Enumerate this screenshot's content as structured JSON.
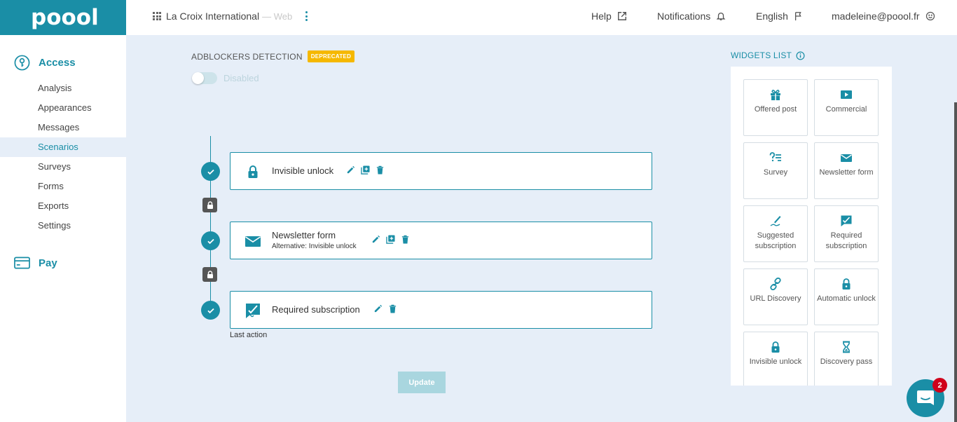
{
  "brand": {
    "logo": "poool",
    "accent": "#1a8ea6"
  },
  "header": {
    "site_name": "La Croix International",
    "site_type": "— Web",
    "help": "Help",
    "notifications": "Notifications",
    "language": "English",
    "user": "madeleine@poool.fr"
  },
  "sidebar": {
    "access_title": "Access",
    "pay_title": "Pay",
    "items": [
      {
        "label": "Analysis"
      },
      {
        "label": "Appearances"
      },
      {
        "label": "Messages"
      },
      {
        "label": "Scenarios"
      },
      {
        "label": "Surveys"
      },
      {
        "label": "Forms"
      },
      {
        "label": "Exports"
      },
      {
        "label": "Settings"
      }
    ]
  },
  "adblock": {
    "title": "ADBLOCKERS DETECTION",
    "badge": "DEPRECATED",
    "toggle_label": "Disabled",
    "enabled": false
  },
  "steps": [
    {
      "title": "Invisible unlock",
      "subtitle": "",
      "icon": "lock-icon"
    },
    {
      "title": "Newsletter form",
      "subtitle": "Alternative: Invisible unlock",
      "icon": "envelope-icon"
    },
    {
      "title": "Required subscription",
      "subtitle": "",
      "icon": "required-subscription-icon"
    }
  ],
  "last_action": "Last action",
  "update_button": "Update",
  "widgets": {
    "title": "WIDGETS LIST",
    "items": [
      {
        "label": "Offered post",
        "icon": "gift-icon"
      },
      {
        "label": "Commercial",
        "icon": "video-icon"
      },
      {
        "label": "Survey",
        "icon": "survey-icon"
      },
      {
        "label": "Newsletter form",
        "icon": "envelope-icon"
      },
      {
        "label": "Suggested subscription",
        "icon": "signature-icon"
      },
      {
        "label": "Required subscription",
        "icon": "required-subscription-icon"
      },
      {
        "label": "URL Discovery",
        "icon": "link-icon"
      },
      {
        "label": "Automatic unlock",
        "icon": "lock-icon"
      },
      {
        "label": "Invisible unlock",
        "icon": "lock-icon"
      },
      {
        "label": "Discovery pass",
        "icon": "hourglass-icon"
      }
    ]
  },
  "chat": {
    "unread_count": "2"
  }
}
